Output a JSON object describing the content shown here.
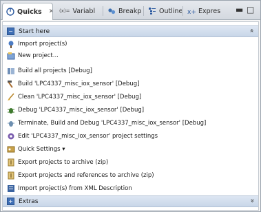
{
  "tabs": [
    {
      "label": "Quicks",
      "icon": "quickstart-icon",
      "active": true,
      "close": "✕"
    },
    {
      "label": "Variabl",
      "icon": "variables-icon",
      "prefix": "(x)="
    },
    {
      "label": "Breakp",
      "icon": "breakpoints-icon"
    },
    {
      "label": "Outline",
      "icon": "outline-icon"
    },
    {
      "label": "Expres",
      "icon": "expressions-icon"
    }
  ],
  "window_controls": {
    "minimize": "▬",
    "maximize": "□"
  },
  "sections": {
    "start": {
      "label": "Start here",
      "collapse_glyph": "»"
    },
    "extras": {
      "label": "Extras",
      "expand_glyph": "»"
    }
  },
  "items": [
    {
      "label": "Import project(s)",
      "icon": "import-icon"
    },
    {
      "label": "New project...",
      "icon": "new-project-icon"
    },
    {
      "label": "Build all projects [Debug]",
      "icon": "build-all-icon"
    },
    {
      "label": "Build 'LPC4337_misc_iox_sensor' [Debug]",
      "icon": "hammer-icon"
    },
    {
      "label": "Clean 'LPC4337_misc_iox_sensor' [Debug]",
      "icon": "broom-icon"
    },
    {
      "label": "Debug 'LPC4337_misc_iox_sensor' [Debug]",
      "icon": "bug-icon"
    },
    {
      "label": "Terminate, Build and Debug 'LPC4337_misc_iox_sensor' [Debug]",
      "icon": "terminate-debug-icon"
    },
    {
      "label": "Edit 'LPC4337_misc_iox_sensor' project settings",
      "icon": "settings-icon"
    },
    {
      "label": "Quick Settings ▾",
      "icon": "quick-settings-icon"
    },
    {
      "label": "Export projects to archive (zip)",
      "icon": "export-icon"
    },
    {
      "label": "Export projects and references to archive (zip)",
      "icon": "export-refs-icon"
    },
    {
      "label": "Import project(s) from XML Description",
      "icon": "import-xml-icon"
    }
  ],
  "colors": {
    "section_bg": "#c8d6e8",
    "accent": "#3f6fb5"
  }
}
